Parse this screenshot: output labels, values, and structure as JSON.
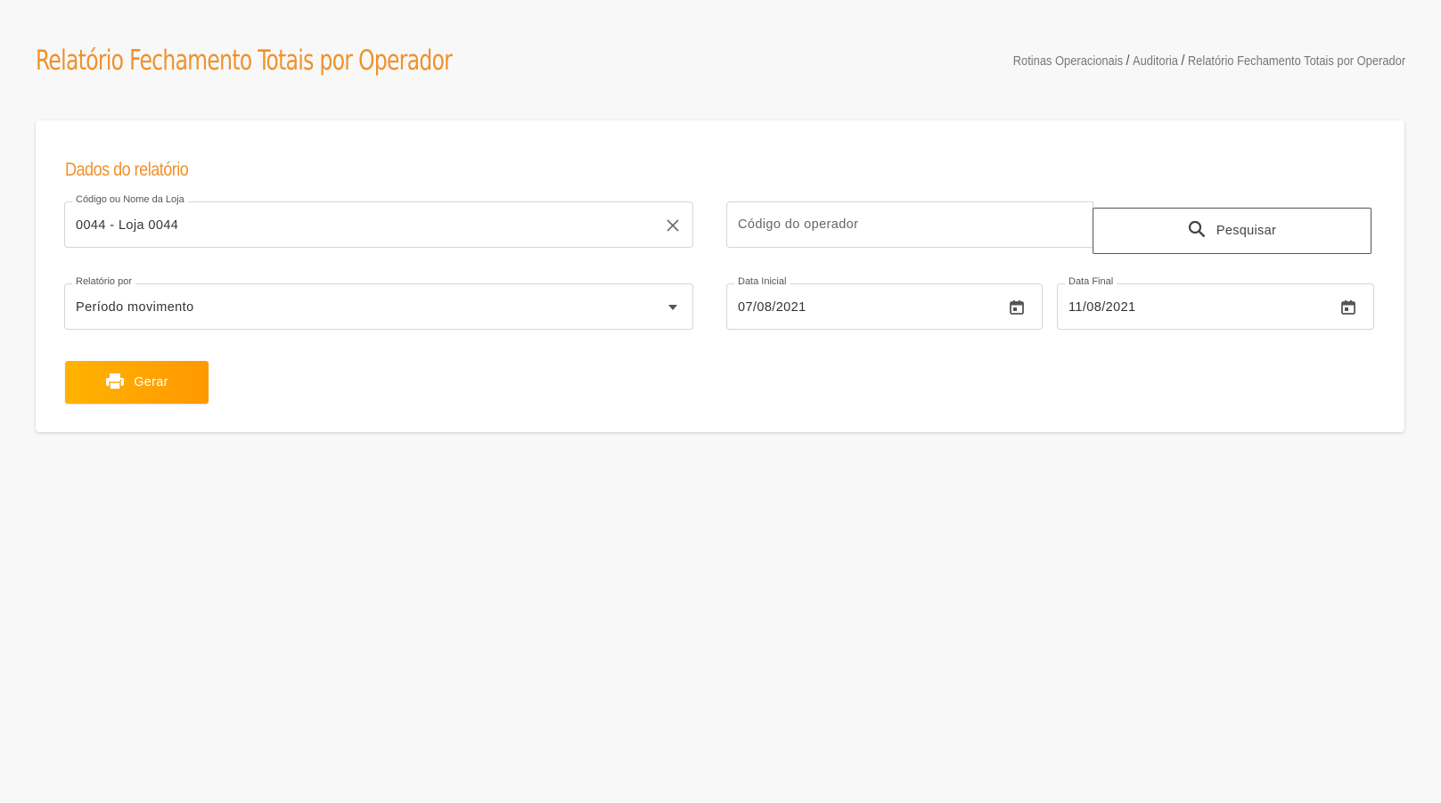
{
  "header": {
    "title": "Relatório Fechamento Totais por Operador",
    "breadcrumb": [
      "Rotinas Operacionais",
      "Auditoria",
      "Relatório Fechamento Totais por Operador"
    ],
    "breadcrumb_separator": "/"
  },
  "card": {
    "section_title": "Dados do relatório",
    "store_field": {
      "label": "Código ou Nome da Loja",
      "value": "0044 - Loja 0044",
      "clear_icon": "close-icon"
    },
    "operator_field": {
      "placeholder": "Código do operador"
    },
    "search_button": {
      "label": "Pesquisar",
      "icon": "search-icon"
    },
    "report_by": {
      "label": "Relatório por",
      "value": "Período movimento",
      "icon": "chevron-down-icon"
    },
    "start_date": {
      "label": "Data Inicial",
      "value": "07/08/2021",
      "icon": "calendar-icon"
    },
    "end_date": {
      "label": "Data Final",
      "value": "11/08/2021",
      "icon": "calendar-icon"
    },
    "generate_button": {
      "label": "Gerar",
      "icon": "printer-icon"
    }
  },
  "colors": {
    "accent": "#f0912a",
    "button_gradient_start": "#ffb300",
    "button_gradient_end": "#ff9800",
    "background": "#f8f8f8"
  }
}
